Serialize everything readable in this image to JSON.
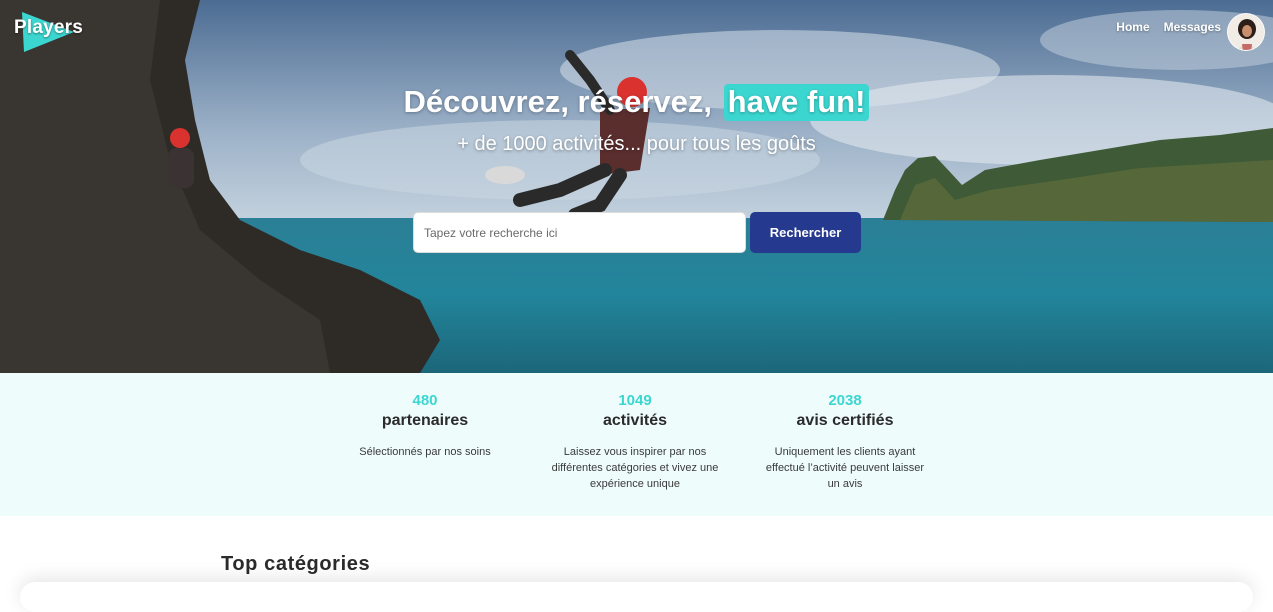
{
  "brand": {
    "name": "Players",
    "accent": "#3cd6d0",
    "primary": "#253a8e"
  },
  "nav": {
    "home": "Home",
    "messages": "Messages"
  },
  "hero": {
    "title_part1": "Découvrez, réservez,",
    "title_highlight": "have fun!",
    "subtitle": "+ de 1000 activités... pour tous les goûts"
  },
  "search": {
    "placeholder": "Tapez votre recherche ici",
    "button_label": "Rechercher"
  },
  "stats": [
    {
      "number": "480",
      "label": "partenaires",
      "description": "Sélectionnés par nos soins"
    },
    {
      "number": "1049",
      "label": "activités",
      "description": "Laissez vous inspirer par nos différentes catégories et vivez une expérience unique"
    },
    {
      "number": "2038",
      "label": "avis certifiés",
      "description": "Uniquement les clients ayant effectué l’activité peuvent laisser un avis"
    }
  ],
  "sections": {
    "top_categories": "Top catégories"
  }
}
